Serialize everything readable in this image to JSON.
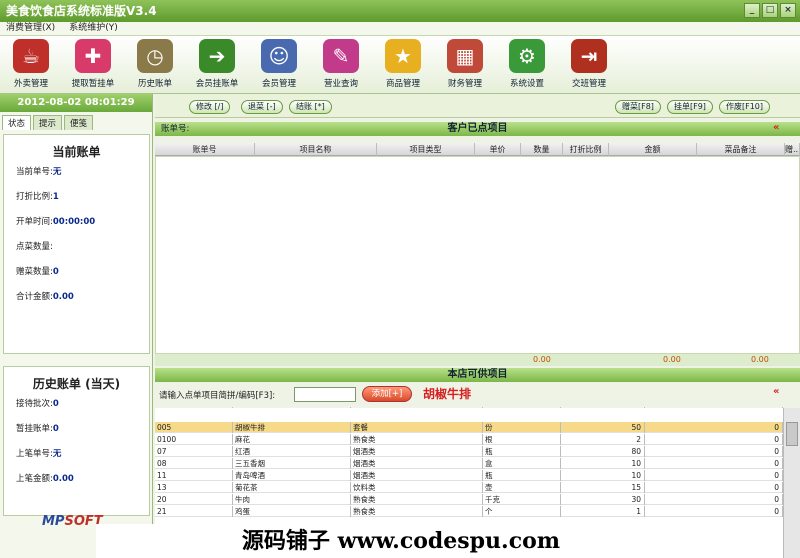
{
  "window": {
    "title": "美食饮食店系统标准版V3.4",
    "controls": [
      "_",
      "□",
      "×"
    ]
  },
  "menu": [
    "消费管理(X)",
    "系统维护(Y)"
  ],
  "toolbar": [
    {
      "label": "外卖管理",
      "icon": "takeaway-icon",
      "color": "#c0302a",
      "glyph": "☕"
    },
    {
      "label": "提取暂挂单",
      "icon": "retrieve-icon",
      "color": "#d83a6a",
      "glyph": "✚"
    },
    {
      "label": "历史账单",
      "icon": "clock-icon",
      "color": "#8a7a4a",
      "glyph": "◷"
    },
    {
      "label": "会员挂账单",
      "icon": "arrow-icon",
      "color": "#3a8a2a",
      "glyph": "➔"
    },
    {
      "label": "会员管理",
      "icon": "members-icon",
      "color": "#4a6ab0",
      "glyph": "☺"
    },
    {
      "label": "营业查询",
      "icon": "query-icon",
      "color": "#c23a8a",
      "glyph": "✎"
    },
    {
      "label": "商品管理",
      "icon": "star-icon",
      "color": "#e8b020",
      "glyph": "★"
    },
    {
      "label": "财务管理",
      "icon": "finance-icon",
      "color": "#c04a3a",
      "glyph": "▦"
    },
    {
      "label": "系统设置",
      "icon": "gear-icon",
      "color": "#3a9a3a",
      "glyph": "⚙"
    },
    {
      "label": "交班管理",
      "icon": "exit-icon",
      "color": "#b03020",
      "glyph": "⇥"
    }
  ],
  "left": {
    "datetime": "2012-08-02 08:01:29",
    "tabs": [
      "状态",
      "提示",
      "便笺"
    ],
    "current_bill": {
      "title": "当前账单",
      "rows": [
        {
          "label": "当前单号:",
          "value": "无"
        },
        {
          "label": "打折比例:",
          "value": "1"
        },
        {
          "label": "开单时间:",
          "value": "00:00:00"
        },
        {
          "label": "点菜数量:",
          "value": ""
        },
        {
          "label": "赠菜数量:",
          "value": "0"
        },
        {
          "label": "合计金额:",
          "value": "0.00"
        }
      ]
    },
    "history": {
      "title": "历史账单 (当天)",
      "rows": [
        {
          "label": "接待批次:",
          "value": "0"
        },
        {
          "label": "暂挂账单:",
          "value": "0"
        },
        {
          "label": "上笔单号:",
          "value": "无"
        },
        {
          "label": "上笔金额:",
          "value": "0.00"
        }
      ]
    },
    "logo": {
      "a": "MP",
      "b": "SOFT"
    }
  },
  "main": {
    "actions_left": [
      "修改 [/]",
      "退菜 [-]",
      "结账 [*]"
    ],
    "actions_right": [
      "赠菜[F8]",
      "挂单[F9]",
      "作废[F10]"
    ],
    "ordered": {
      "bill_label": "账单号:",
      "title": "客户已点项目",
      "columns": [
        "账单号",
        "项目名称",
        "项目类型",
        "单价",
        "数量",
        "打折比例",
        "金额",
        "菜品备注",
        "赠..."
      ],
      "totals": [
        "0.00",
        "0.00",
        "0.00"
      ]
    },
    "available": {
      "title": "本店可供项目",
      "input_label": "请输入点单项目简拼/编码[F3]:",
      "input_value": "",
      "add_label": "添加[+]",
      "hint": "胡椒牛排",
      "columns": [
        "项目编码",
        "项目名称",
        "项目类型",
        "计价单位",
        "单价",
        "当前库存"
      ],
      "rows": [
        {
          "code": "005",
          "name": "胡椒牛排",
          "type": "套餐",
          "unit": "份",
          "price": "50",
          "stock": "0"
        },
        {
          "code": "0100",
          "name": "麻花",
          "type": "熟食类",
          "unit": "根",
          "price": "2",
          "stock": "0"
        },
        {
          "code": "07",
          "name": "红酒",
          "type": "烟酒类",
          "unit": "瓶",
          "price": "80",
          "stock": "0"
        },
        {
          "code": "08",
          "name": "三五香烟",
          "type": "烟酒类",
          "unit": "盒",
          "price": "10",
          "stock": "0"
        },
        {
          "code": "11",
          "name": "青岛啤酒",
          "type": "烟酒类",
          "unit": "瓶",
          "price": "10",
          "stock": "0"
        },
        {
          "code": "13",
          "name": "菊花茶",
          "type": "饮料类",
          "unit": "壶",
          "price": "15",
          "stock": "0"
        },
        {
          "code": "20",
          "name": "牛肉",
          "type": "熟食类",
          "unit": "千克",
          "price": "30",
          "stock": "0"
        },
        {
          "code": "21",
          "name": "鸡蛋",
          "type": "熟食类",
          "unit": "个",
          "price": "1",
          "stock": "0"
        }
      ]
    }
  },
  "watermark": "源码铺子 www.codespu.com"
}
